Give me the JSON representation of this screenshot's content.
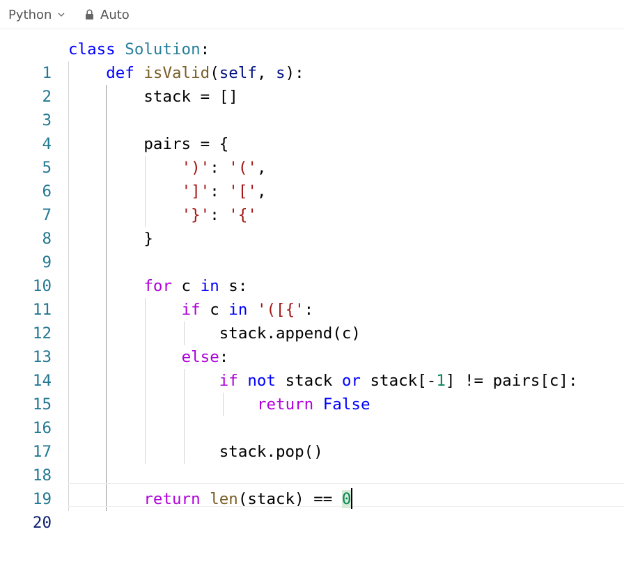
{
  "toolbar": {
    "language": "Python",
    "language_icon": "chevron-down-icon",
    "format_icon": "lock-icon",
    "format_label": "Auto"
  },
  "editor": {
    "active_line": 20,
    "lines": [
      {
        "n": "1"
      },
      {
        "n": "2"
      },
      {
        "n": "3"
      },
      {
        "n": "4"
      },
      {
        "n": "5"
      },
      {
        "n": "6"
      },
      {
        "n": "7"
      },
      {
        "n": "8"
      },
      {
        "n": "9"
      },
      {
        "n": "10"
      },
      {
        "n": "11"
      },
      {
        "n": "12"
      },
      {
        "n": "13"
      },
      {
        "n": "14"
      },
      {
        "n": "15"
      },
      {
        "n": "16"
      },
      {
        "n": "17"
      },
      {
        "n": "18"
      },
      {
        "n": "19"
      },
      {
        "n": "20"
      }
    ],
    "tokens": {
      "l1": [
        "class",
        " ",
        "Solution",
        ":"
      ],
      "l2": [
        "    ",
        "def",
        " ",
        "isValid",
        "(",
        "self",
        ", ",
        "s",
        "):"
      ],
      "l3": [
        "        stack = []"
      ],
      "l5": [
        "        pairs = {"
      ],
      "l6": [
        "            ",
        "')'",
        ": ",
        "'('",
        ","
      ],
      "l7": [
        "            ",
        "']'",
        ": ",
        "'['",
        ","
      ],
      "l8": [
        "            ",
        "'}'",
        ": ",
        "'{'"
      ],
      "l9": [
        "        }"
      ],
      "l11": [
        "        ",
        "for",
        " c ",
        "in",
        " s:"
      ],
      "l12": [
        "            ",
        "if",
        " c ",
        "in",
        " ",
        "'([{'",
        ":"
      ],
      "l13": [
        "                stack.append(c)"
      ],
      "l14": [
        "            ",
        "else",
        ":"
      ],
      "l15": [
        "                ",
        "if",
        " ",
        "not",
        " stack ",
        "or",
        " stack[-",
        "1",
        "] != pairs[c]:"
      ],
      "l16": [
        "                    ",
        "return",
        " ",
        "False"
      ],
      "l18": [
        "                stack.pop()"
      ],
      "l20": [
        "        ",
        "return",
        " ",
        "len",
        "(stack) == ",
        "0"
      ]
    }
  }
}
